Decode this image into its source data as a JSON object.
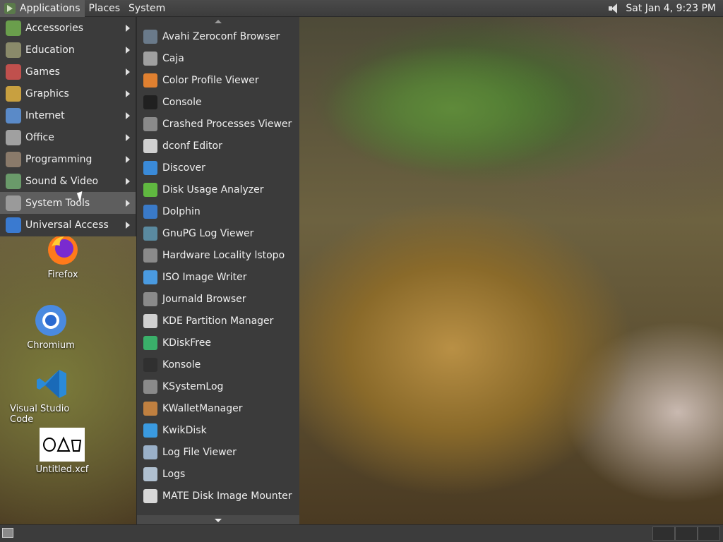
{
  "top_panel": {
    "menus": [
      "Applications",
      "Places",
      "System"
    ],
    "clock": "Sat Jan  4,  9:23 PM"
  },
  "app_menu": {
    "categories": [
      {
        "label": "Accessories",
        "icon": "accessories-icon",
        "color": "#6a9e4c"
      },
      {
        "label": "Education",
        "icon": "education-icon",
        "color": "#8a8a6a"
      },
      {
        "label": "Games",
        "icon": "games-icon",
        "color": "#c0504d"
      },
      {
        "label": "Graphics",
        "icon": "graphics-icon",
        "color": "#c8a040"
      },
      {
        "label": "Internet",
        "icon": "internet-icon",
        "color": "#5a8ac8"
      },
      {
        "label": "Office",
        "icon": "office-icon",
        "color": "#a0a0a0"
      },
      {
        "label": "Programming",
        "icon": "programming-icon",
        "color": "#8a7a6a"
      },
      {
        "label": "Sound & Video",
        "icon": "sound-video-icon",
        "color": "#6a9a6a"
      },
      {
        "label": "System Tools",
        "icon": "system-tools-icon",
        "color": "#9a9a9a"
      },
      {
        "label": "Universal Access",
        "icon": "universal-access-icon",
        "color": "#3a7ad0"
      }
    ],
    "selected_index": 8
  },
  "submenu": {
    "items": [
      {
        "label": "Avahi Zeroconf Browser",
        "icon": "avahi-icon",
        "color": "#6a7a8a"
      },
      {
        "label": "Caja",
        "icon": "caja-icon",
        "color": "#a0a0a0"
      },
      {
        "label": "Color Profile Viewer",
        "icon": "color-profile-icon",
        "color": "#e08030"
      },
      {
        "label": "Console",
        "icon": "console-icon",
        "color": "#202020"
      },
      {
        "label": "Crashed Processes Viewer",
        "icon": "crashed-processes-icon",
        "color": "#8a8a8a"
      },
      {
        "label": "dconf Editor",
        "icon": "dconf-icon",
        "color": "#d0d0d0"
      },
      {
        "label": "Discover",
        "icon": "discover-icon",
        "color": "#3a8ad8"
      },
      {
        "label": "Disk Usage Analyzer",
        "icon": "disk-usage-icon",
        "color": "#60b840"
      },
      {
        "label": "Dolphin",
        "icon": "dolphin-icon",
        "color": "#3a7ac8"
      },
      {
        "label": "GnuPG Log Viewer",
        "icon": "gnupg-icon",
        "color": "#5a8aa0"
      },
      {
        "label": "Hardware Locality lstopo",
        "icon": "hwloc-icon",
        "color": "#8a8a8a"
      },
      {
        "label": "ISO Image Writer",
        "icon": "iso-writer-icon",
        "color": "#4a9ae0"
      },
      {
        "label": "Journald Browser",
        "icon": "journald-icon",
        "color": "#8a8a8a"
      },
      {
        "label": "KDE Partition Manager",
        "icon": "partition-manager-icon",
        "color": "#d0d0d0"
      },
      {
        "label": "KDiskFree",
        "icon": "kdiskfree-icon",
        "color": "#3ab06a"
      },
      {
        "label": "Konsole",
        "icon": "konsole-icon",
        "color": "#303030"
      },
      {
        "label": "KSystemLog",
        "icon": "ksystemlog-icon",
        "color": "#8a8a8a"
      },
      {
        "label": "KWalletManager",
        "icon": "kwallet-icon",
        "color": "#c08040"
      },
      {
        "label": "KwikDisk",
        "icon": "kwikdisk-icon",
        "color": "#3a9ae0"
      },
      {
        "label": "Log File Viewer",
        "icon": "log-viewer-icon",
        "color": "#9ab0c8"
      },
      {
        "label": "Logs",
        "icon": "logs-icon",
        "color": "#b0c0d0"
      },
      {
        "label": "MATE Disk Image Mounter",
        "icon": "disk-mounter-icon",
        "color": "#d8d8d8"
      }
    ]
  },
  "desktop": {
    "icons": [
      {
        "label": "Firefox",
        "icon": "firefox-icon"
      },
      {
        "label": "Chromium",
        "icon": "chromium-icon"
      },
      {
        "label": "Visual Studio Code",
        "icon": "vscode-icon"
      },
      {
        "label": "Untitled.xcf",
        "icon": "xcf-file-icon"
      }
    ]
  }
}
